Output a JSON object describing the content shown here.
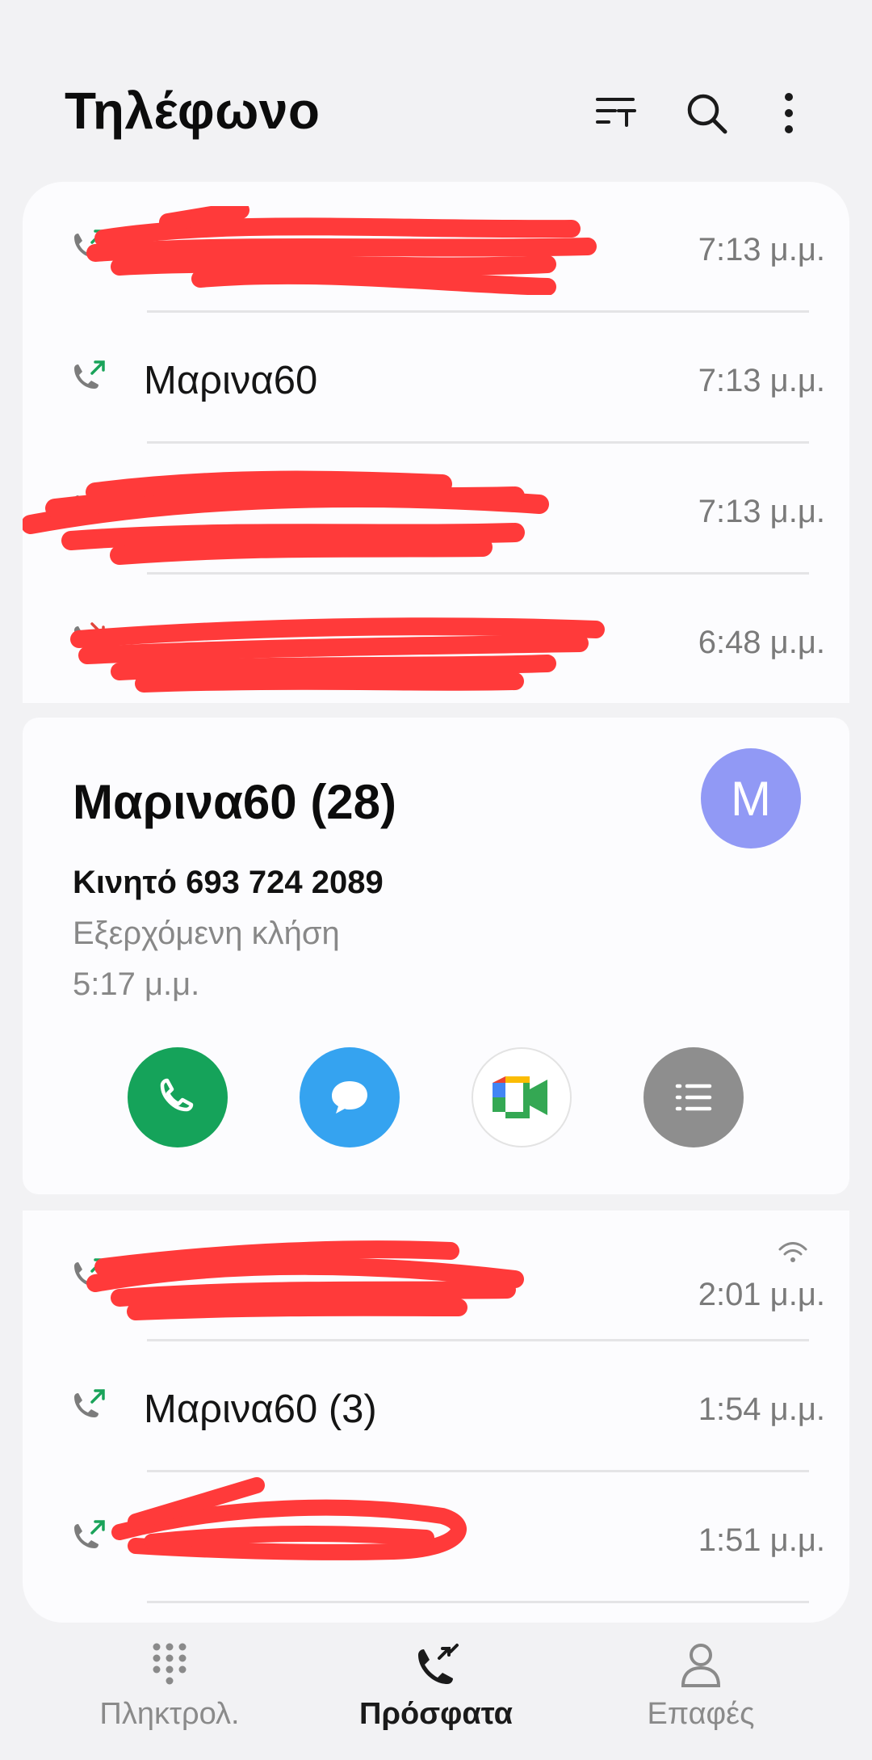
{
  "header": {
    "title": "Τηλέφωνο"
  },
  "recent_top": [
    {
      "name": "",
      "time": "7:13 μ.μ.",
      "type": "outgoing",
      "redacted": true
    },
    {
      "name": "Μαρινα60",
      "time": "7:13 μ.μ.",
      "type": "outgoing",
      "redacted": false
    },
    {
      "name": "",
      "time": "7:13 μ.μ.",
      "type": "outgoing",
      "redacted": true
    },
    {
      "name": "",
      "time": "6:48 μ.μ.",
      "type": "missed",
      "redacted": true
    }
  ],
  "detail": {
    "name": "Μαρινα60 (28)",
    "avatar_letter": "M",
    "phone": "Κινητό 693 724 2089",
    "call_type": "Εξερχόμενη κλήση",
    "time": "5:17 μ.μ."
  },
  "recent_bottom": [
    {
      "name": "",
      "time": "2:01 μ.μ.",
      "type": "outgoing",
      "wifi": true,
      "redacted": true
    },
    {
      "name": "Μαρινα60 (3)",
      "time": "1:54 μ.μ.",
      "type": "outgoing",
      "redacted": false
    },
    {
      "name": "",
      "time": "1:51 μ.μ.",
      "type": "outgoing",
      "redacted": true
    }
  ],
  "nav": {
    "keypad": "Πληκτρολ.",
    "recents": "Πρόσφατα",
    "contacts": "Επαφές"
  },
  "colors": {
    "outgoing_arrow": "#1aa35a",
    "missed_arrow": "#e0463c",
    "call_button": "#15a35a",
    "message_button": "#35a3f0",
    "details_button": "#8e8e8e",
    "avatar": "#9199f5",
    "redaction": "#ff3a3a"
  }
}
